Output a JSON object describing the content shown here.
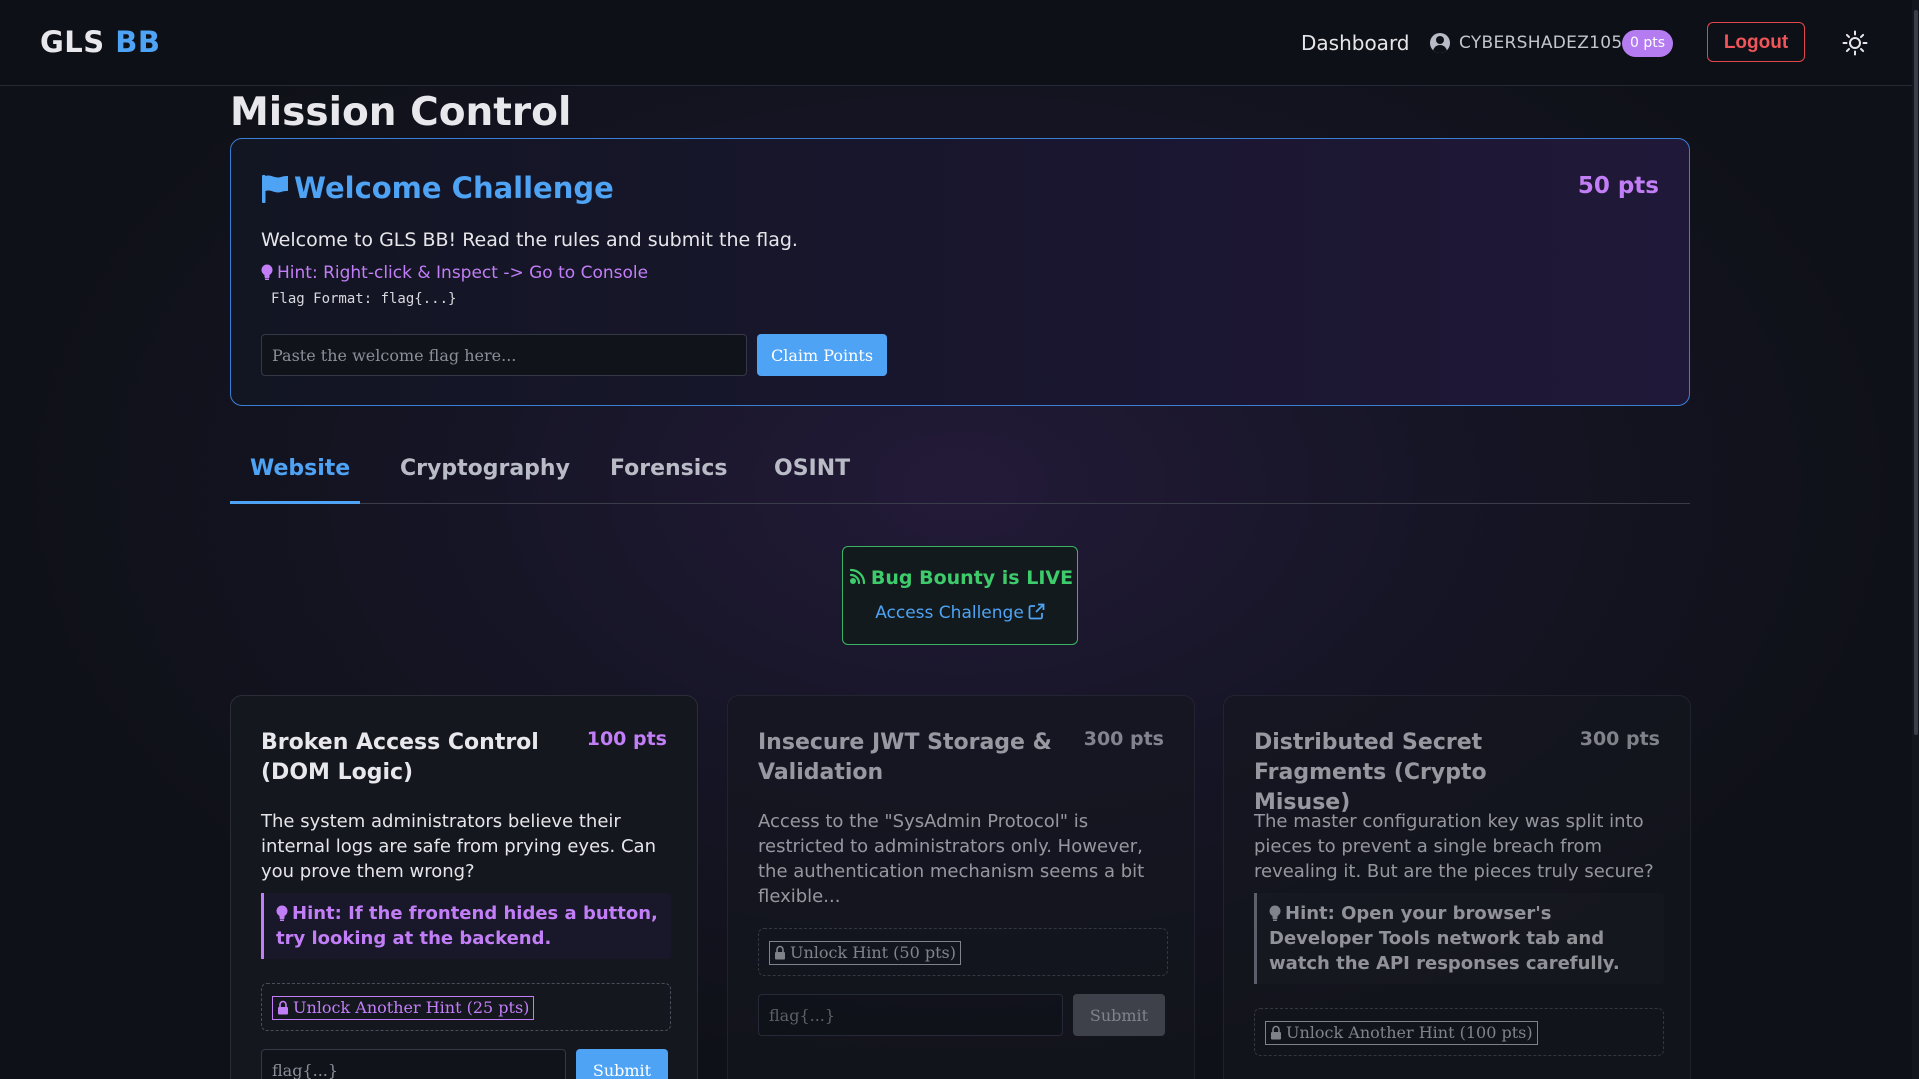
{
  "nav": {
    "brand_part1": "GLS",
    "brand_part2": "BB",
    "dashboard_label": "Dashboard",
    "username": "CYBERSHADEZ105",
    "points_badge": "0 pts",
    "logout_label": "Logout",
    "theme_icon": "sun-icon"
  },
  "page": {
    "title": "Mission Control"
  },
  "welcome": {
    "icon": "flag-icon",
    "title": "Welcome Challenge",
    "points": "50 pts",
    "description": "Welcome to GLS BB! Read the rules and submit the flag.",
    "hint": "Hint: Right-click & Inspect -> Go to Console",
    "flag_format": "Flag Format: flag{...}",
    "input_placeholder": "Paste the welcome flag here...",
    "button_label": "Claim Points"
  },
  "tabs": [
    {
      "label": "Website",
      "active": true
    },
    {
      "label": "Cryptography",
      "active": false
    },
    {
      "label": "Forensics",
      "active": false
    },
    {
      "label": "OSINT",
      "active": false
    }
  ],
  "bug_bounty": {
    "icon": "broadcast-icon",
    "title": "Bug Bounty is LIVE",
    "link_label": "Access Challenge",
    "link_icon": "external-link-icon"
  },
  "challenges": [
    {
      "title": "Broken Access Control (DOM Logic)",
      "points": "100 pts",
      "description": "The system administrators believe their internal logs are safe from prying eyes. Can you prove them wrong?",
      "hint": "Hint: If the frontend hides a button, try looking at the backend.",
      "unlock_label": "Unlock Another Hint (25 pts)",
      "flag_placeholder": "flag{...}",
      "submit_label": "Submit"
    },
    {
      "title": "Insecure JWT Storage & Validation",
      "points": "300 pts",
      "description": "Access to the \"SysAdmin Protocol\" is restricted to administrators only. However, the authentication mechanism seems a bit flexible...",
      "unlock_label": "Unlock Hint (50 pts)",
      "flag_placeholder": "flag{...}",
      "submit_label": "Submit"
    },
    {
      "title": "Distributed Secret Fragments (Crypto Misuse)",
      "points": "300 pts",
      "description": "The master configuration key was split into pieces to prevent a single breach from revealing it. But are the pieces truly secure?",
      "hint": "Hint: Open your browser's Developer Tools network tab and watch the API responses carefully.",
      "unlock_label": "Unlock Another Hint (100 pts)"
    }
  ],
  "colors": {
    "accent_blue": "#4ea3f5",
    "accent_purple": "#c27ef6",
    "success_green": "#3ecb6b",
    "danger_red": "#f0555a"
  }
}
